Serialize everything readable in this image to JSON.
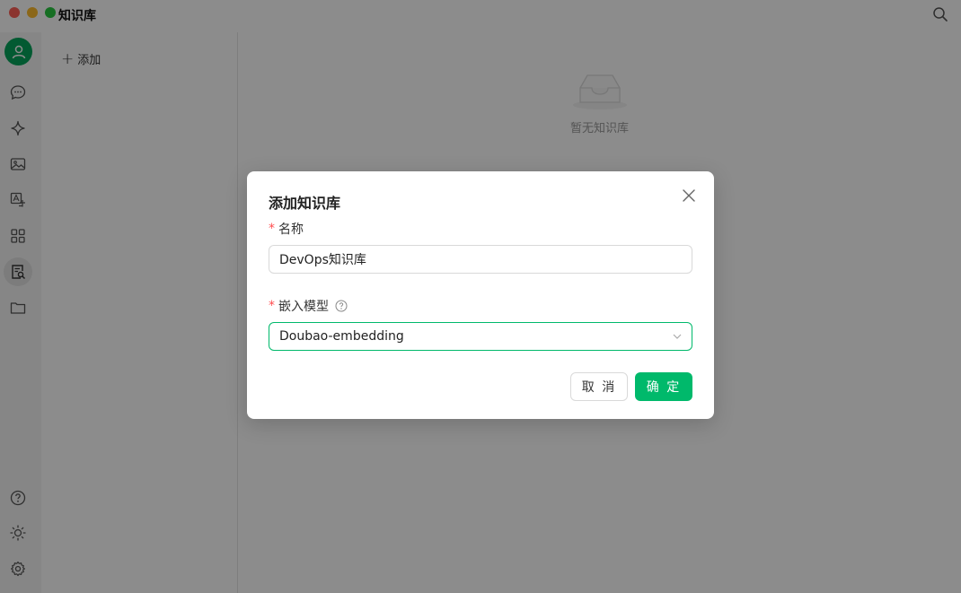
{
  "window": {
    "title": "知识库"
  },
  "sidebar": {
    "add_label": "添加"
  },
  "main": {
    "empty_text": "暂无知识库"
  },
  "modal": {
    "title": "添加知识库",
    "name_label": "名称",
    "name_value": "DevOps知识库",
    "model_label": "嵌入模型",
    "model_value": "Doubao-embedding",
    "cancel_label": "取 消",
    "ok_label": "确 定",
    "required_mark": "*"
  },
  "colors": {
    "accent": "#00b96b",
    "avatar": "#07a45b",
    "required": "#ff4d4f"
  },
  "rail_icons": [
    "user-icon",
    "chat-icon",
    "sparkle-icon",
    "image-icon",
    "translate-icon",
    "apps-icon",
    "knowledge-icon",
    "folder-icon",
    "help-icon",
    "theme-icon",
    "settings-icon"
  ]
}
